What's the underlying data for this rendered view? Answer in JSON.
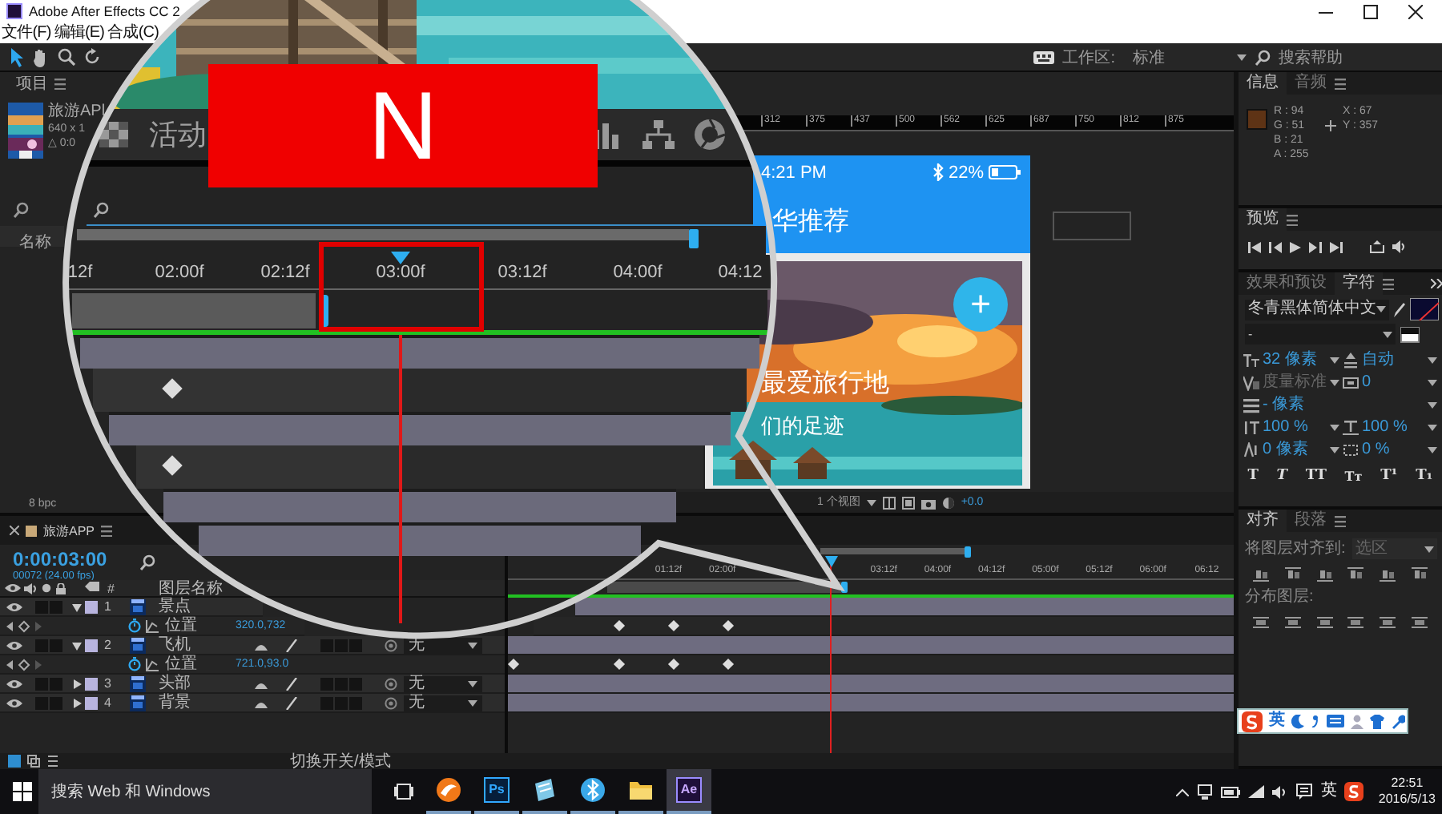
{
  "window": {
    "title": "Adobe After Effects CC 2"
  },
  "menu": [
    "文件(F)",
    "编辑(E)",
    "合成(C)"
  ],
  "toolbar": {
    "workspace_label": "工作区:",
    "workspace": "标准",
    "search": "搜索帮助"
  },
  "project": {
    "title": "项目",
    "item": {
      "name": "旅游APl",
      "size": "640 x 1",
      "duration": "△ 0:0"
    },
    "column": "名称",
    "bit_depth": "8 bpc"
  },
  "viewer": {
    "ruler": [
      "312",
      "375",
      "437",
      "500",
      "562",
      "625",
      "687",
      "750",
      "812",
      "875"
    ],
    "phone": {
      "time": "4:21 PM",
      "battery": "22%",
      "title": "华推荐",
      "headline": "最爱旅行地",
      "subline": "们的足迹",
      "fab": "+"
    },
    "views": "1 个视图",
    "exposure": "+0.0"
  },
  "info": {
    "tabs": [
      {
        "label": "信息",
        "selected": true
      },
      {
        "label": "音频",
        "selected": false
      }
    ],
    "color": "#5e3315",
    "channels": [
      "R : 94",
      "G : 51",
      "B : 21",
      "A : 255"
    ],
    "position": [
      "X : 67",
      "Y : 357"
    ]
  },
  "preview": {
    "title": "预览"
  },
  "character": {
    "tabs": [
      {
        "label": "效果和预设",
        "selected": false
      },
      {
        "label": "字符",
        "selected": true
      }
    ],
    "font": "冬青黑体简体中文",
    "style": "-",
    "fields": [
      {
        "kind": "size",
        "value": "32 像素",
        "disabled": false
      },
      {
        "kind": "leading",
        "value": "自动",
        "disabled": false
      },
      {
        "kind": "kerning",
        "value": "度量标准",
        "disabled": true
      },
      {
        "kind": "tracking",
        "value": "0",
        "disabled": false
      },
      {
        "kind": "stroke",
        "value": "- 像素",
        "disabled": false
      },
      {
        "kind": "vscale",
        "value": "100 %",
        "disabled": false
      },
      {
        "kind": "hscale",
        "value": "100 %",
        "disabled": false
      },
      {
        "kind": "baseline",
        "value": "0 像素",
        "disabled": false
      },
      {
        "kind": "tsume",
        "value": "0 %",
        "disabled": false
      }
    ],
    "styles": [
      {
        "kind": "bold",
        "label": "T"
      },
      {
        "kind": "italic",
        "label": "T"
      },
      {
        "kind": "caps",
        "label": "TT"
      },
      {
        "kind": "smallcaps",
        "label": "Tт"
      },
      {
        "kind": "super",
        "label": "T¹"
      },
      {
        "kind": "sub",
        "label": "T₁"
      }
    ]
  },
  "align": {
    "tabs": [
      {
        "label": "对齐",
        "selected": true
      },
      {
        "label": "段落",
        "selected": false
      }
    ],
    "align_to_label": "将图层对齐到:",
    "align_to": "选区",
    "distribute_label": "分布图层:"
  },
  "ime": {
    "mode": "英"
  },
  "timeline": {
    "tab": "旅游APP",
    "time": "0:00:03:00",
    "frames": "00072 (24.00 fps)",
    "index_header": "#",
    "column": "图层名称",
    "layers": [
      {
        "index": "1",
        "name": "景点",
        "expanded": true,
        "property": {
          "name": "位置",
          "value": "320.0,732"
        }
      },
      {
        "index": "2",
        "name": "飞机",
        "expanded": true,
        "mode": "无",
        "property": {
          "name": "位置",
          "value": "721.0,93.0"
        }
      },
      {
        "index": "3",
        "name": "头部",
        "expanded": false,
        "mode": "无"
      },
      {
        "index": "4",
        "name": "背景",
        "expanded": false,
        "mode": "无"
      }
    ],
    "ruler": [
      "01:12f",
      "02:00f",
      "03:12f",
      "04:00f",
      "04:12f",
      "05:00f",
      "05:12f",
      "06:00f",
      "06:12"
    ],
    "mode_toggle": "切换开关/模式"
  },
  "magnifier": {
    "toolbar_text": "活动",
    "ruler": [
      "12f",
      "02:00f",
      "02:12f",
      "03:00f",
      "03:12f",
      "04:00f",
      "04:12"
    ],
    "key": "N"
  },
  "taskbar": {
    "search": "搜索 Web 和 Windows",
    "apps": [
      {
        "kind": "browser",
        "selected": false
      },
      {
        "kind": "ps",
        "label": "Ps",
        "selected": false
      },
      {
        "kind": "notes",
        "selected": false
      },
      {
        "kind": "bluetooth",
        "selected": false
      },
      {
        "kind": "folder",
        "selected": false
      },
      {
        "kind": "ae",
        "label": "Ae",
        "selected": true
      }
    ],
    "ime": "英",
    "time": "22:51",
    "date": "2016/5/13"
  }
}
